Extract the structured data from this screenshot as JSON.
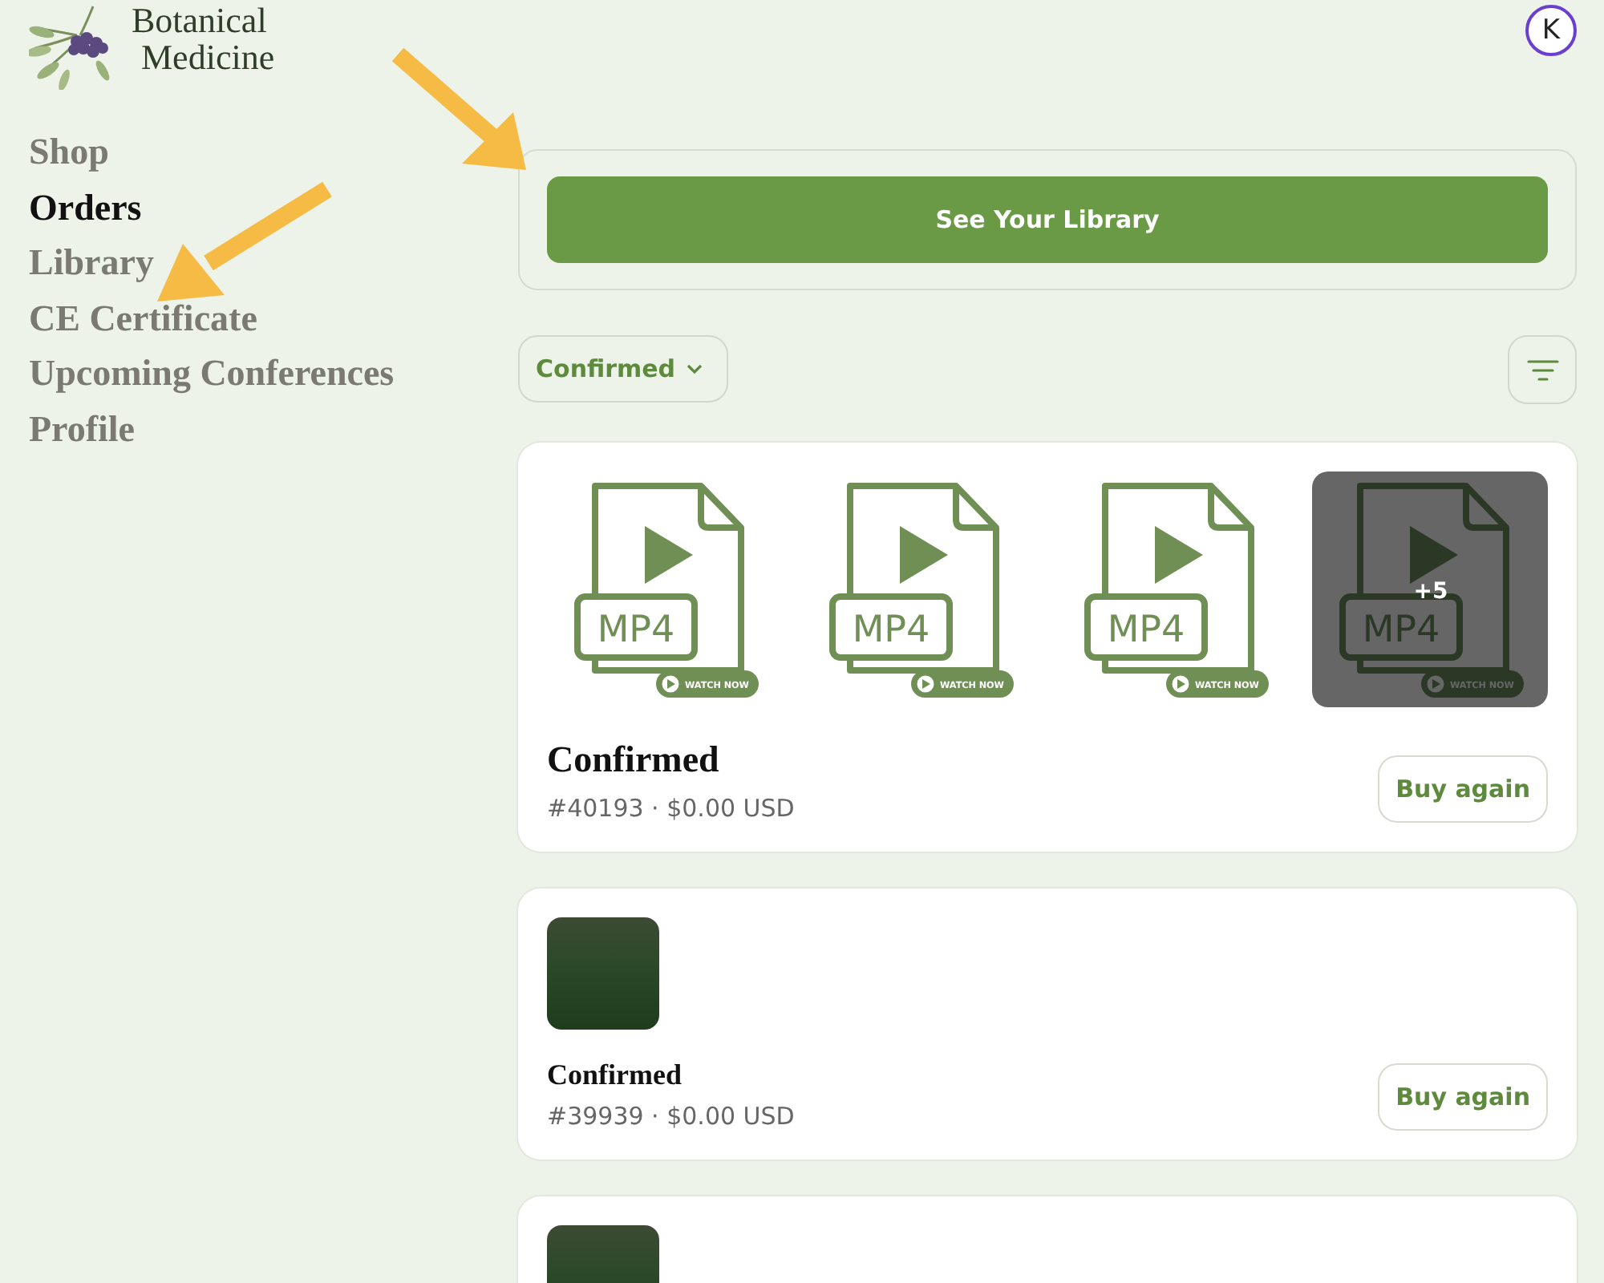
{
  "logo": {
    "lines": [
      "Botanical",
      "Medicine"
    ]
  },
  "avatar": {
    "initial": "K"
  },
  "nav": [
    {
      "label": "Shop",
      "selected": false
    },
    {
      "label": "Orders",
      "selected": true
    },
    {
      "label": "Library",
      "selected": false
    },
    {
      "label": "CE Certificate",
      "selected": false
    },
    {
      "label": "Upcoming Conferences",
      "selected": false
    },
    {
      "label": "Profile",
      "selected": false
    }
  ],
  "library_button": "See Your Library",
  "status_filter": {
    "label": "Confirmed"
  },
  "orders": [
    {
      "kind": "videos",
      "title": "Confirmed",
      "meta": "#40193 · $0.00 USD",
      "action": "Buy again",
      "thumbnails": [
        {
          "label": "MP4",
          "badge": "WATCH NOW"
        },
        {
          "label": "MP4",
          "badge": "WATCH NOW"
        },
        {
          "label": "MP4",
          "badge": "WATCH NOW"
        },
        {
          "label": "MP4",
          "badge": "WATCH NOW",
          "more": "+5"
        }
      ]
    },
    {
      "kind": "photo",
      "title": "Confirmed",
      "meta": "#39939 · $0.00 USD",
      "action": "Buy again"
    },
    {
      "kind": "photo"
    }
  ]
}
